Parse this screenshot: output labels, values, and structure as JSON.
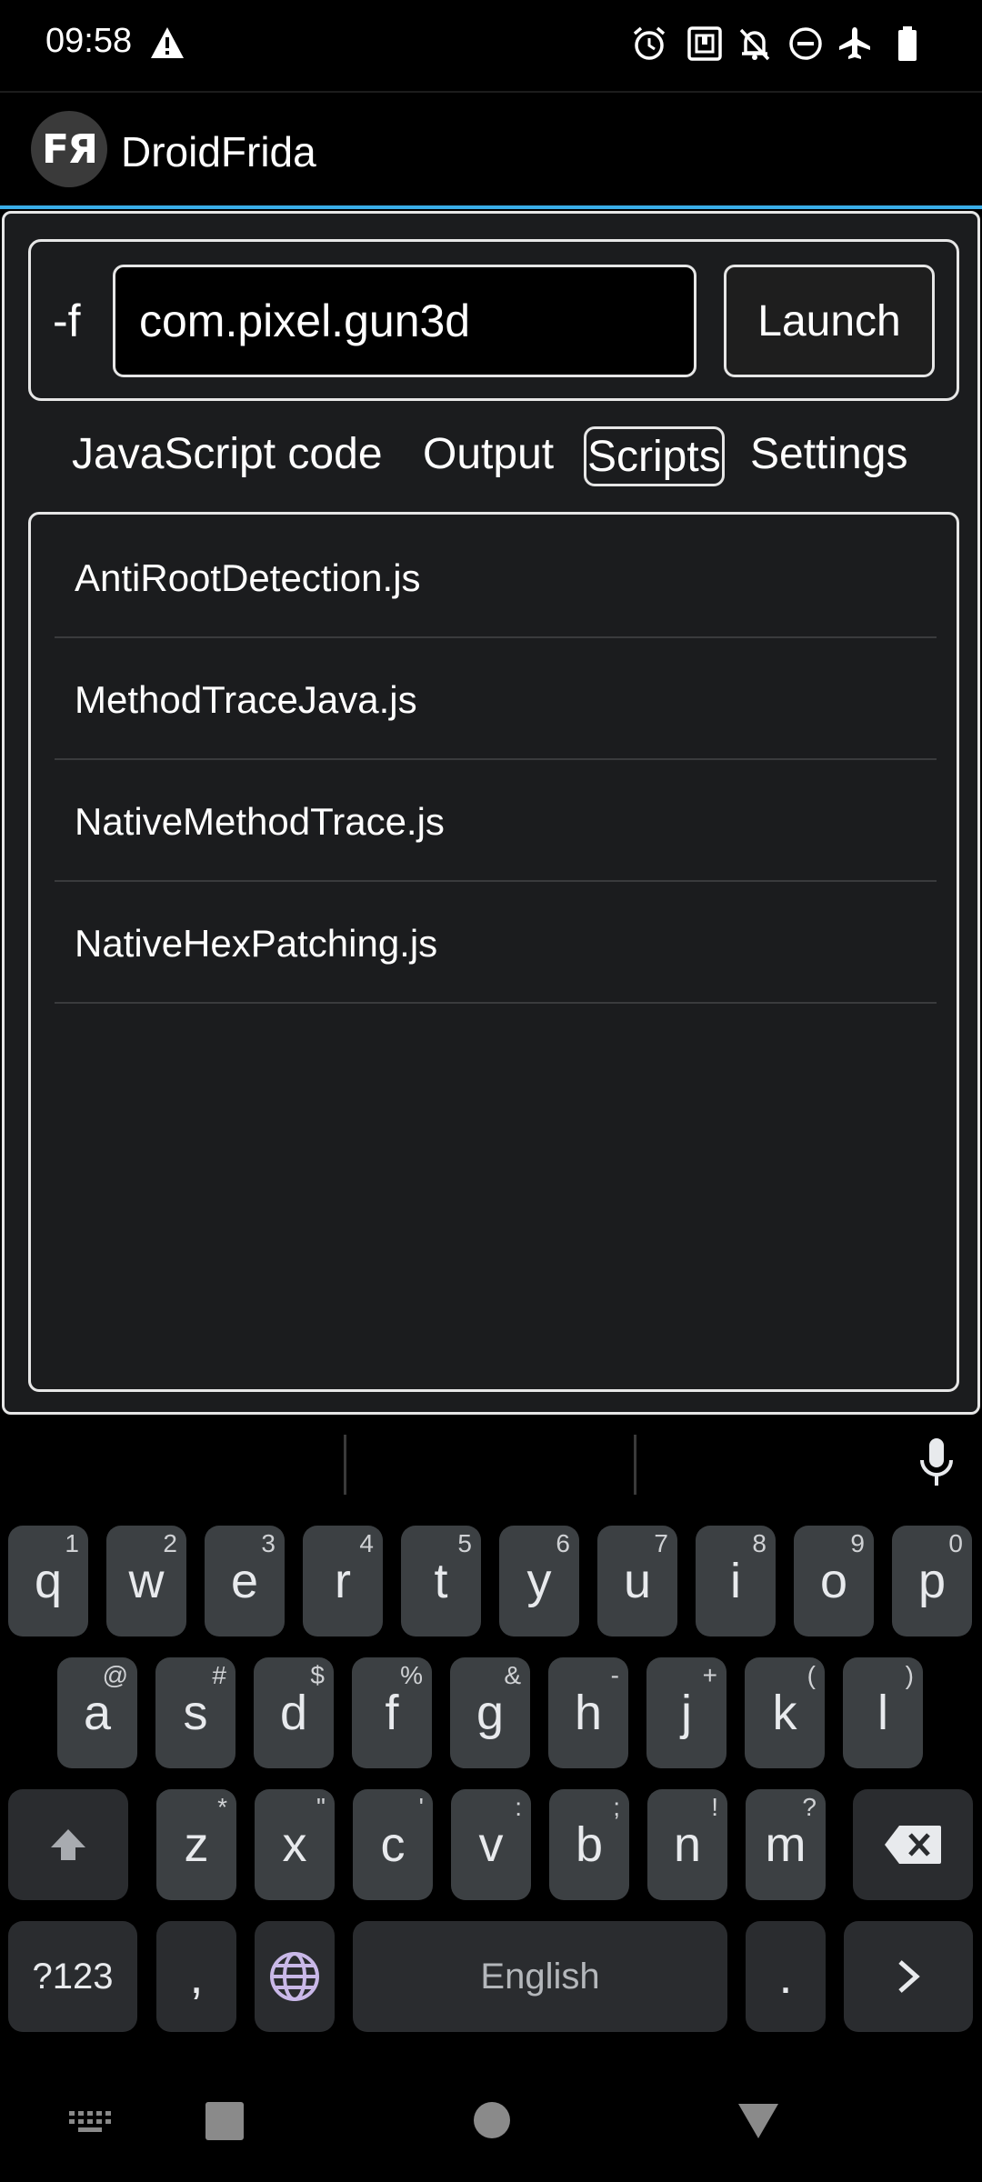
{
  "status_bar": {
    "time": "09:58",
    "icons": [
      "warning-icon",
      "alarm-icon",
      "nfc-icon",
      "notifications-off-icon",
      "do-not-disturb-icon",
      "airplane-mode-icon",
      "battery-icon"
    ]
  },
  "app_bar": {
    "logo_text": "FЯ",
    "title": "DroidFrida"
  },
  "launch": {
    "flag": "-f",
    "package": "com.pixel.gun3d",
    "button_label": "Launch"
  },
  "tabs": [
    {
      "label": "JavaScript code",
      "selected": false
    },
    {
      "label": "Output",
      "selected": false
    },
    {
      "label": "Scripts",
      "selected": true
    },
    {
      "label": "Settings",
      "selected": false
    }
  ],
  "scripts": [
    {
      "name": "AntiRootDetection.js"
    },
    {
      "name": "MethodTraceJava.js"
    },
    {
      "name": "NativeMethodTrace.js"
    },
    {
      "name": "NativeHexPatching.js"
    }
  ],
  "keyboard": {
    "row1": [
      {
        "key": "q",
        "hint": "1"
      },
      {
        "key": "w",
        "hint": "2"
      },
      {
        "key": "e",
        "hint": "3"
      },
      {
        "key": "r",
        "hint": "4"
      },
      {
        "key": "t",
        "hint": "5"
      },
      {
        "key": "y",
        "hint": "6"
      },
      {
        "key": "u",
        "hint": "7"
      },
      {
        "key": "i",
        "hint": "8"
      },
      {
        "key": "o",
        "hint": "9"
      },
      {
        "key": "p",
        "hint": "0"
      }
    ],
    "row2": [
      {
        "key": "a",
        "hint": "@"
      },
      {
        "key": "s",
        "hint": "#"
      },
      {
        "key": "d",
        "hint": "$"
      },
      {
        "key": "f",
        "hint": "%"
      },
      {
        "key": "g",
        "hint": "&"
      },
      {
        "key": "h",
        "hint": "-"
      },
      {
        "key": "j",
        "hint": "+"
      },
      {
        "key": "k",
        "hint": "("
      },
      {
        "key": "l",
        "hint": ")"
      }
    ],
    "row3": [
      {
        "key": "z",
        "hint": "*"
      },
      {
        "key": "x",
        "hint": "\""
      },
      {
        "key": "c",
        "hint": "'"
      },
      {
        "key": "v",
        "hint": ":"
      },
      {
        "key": "b",
        "hint": ";"
      },
      {
        "key": "n",
        "hint": "!"
      },
      {
        "key": "m",
        "hint": "?"
      }
    ],
    "symbols_label": "?123",
    "comma_label": ",",
    "space_label": "English",
    "period_label": "."
  },
  "nav_bar": {
    "icons": [
      "keyboard-hide-icon",
      "recents-icon",
      "home-icon",
      "back-icon"
    ]
  }
}
